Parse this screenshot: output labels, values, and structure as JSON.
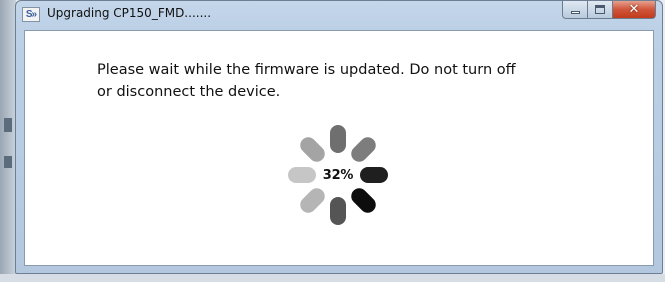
{
  "window": {
    "title": "Upgrading CP150_FMD.......",
    "icon_name": "app-icon",
    "icon_text": "S»",
    "close_glyph": "✕"
  },
  "dialog": {
    "message_line1": "Please wait while the firmware is updated. Do not turn off",
    "message_line2": "or disconnect the device."
  },
  "progress": {
    "percent": 32,
    "percent_label": "32%"
  },
  "colors": {
    "spinner_shades": [
      "#6f6f6f",
      "#7d7d7d",
      "#8a8a8a",
      "#1f1f1f",
      "#0d0d0d",
      "#555555",
      "#b5b5b5",
      "#c6c6c6",
      "#a4a4a4"
    ]
  }
}
